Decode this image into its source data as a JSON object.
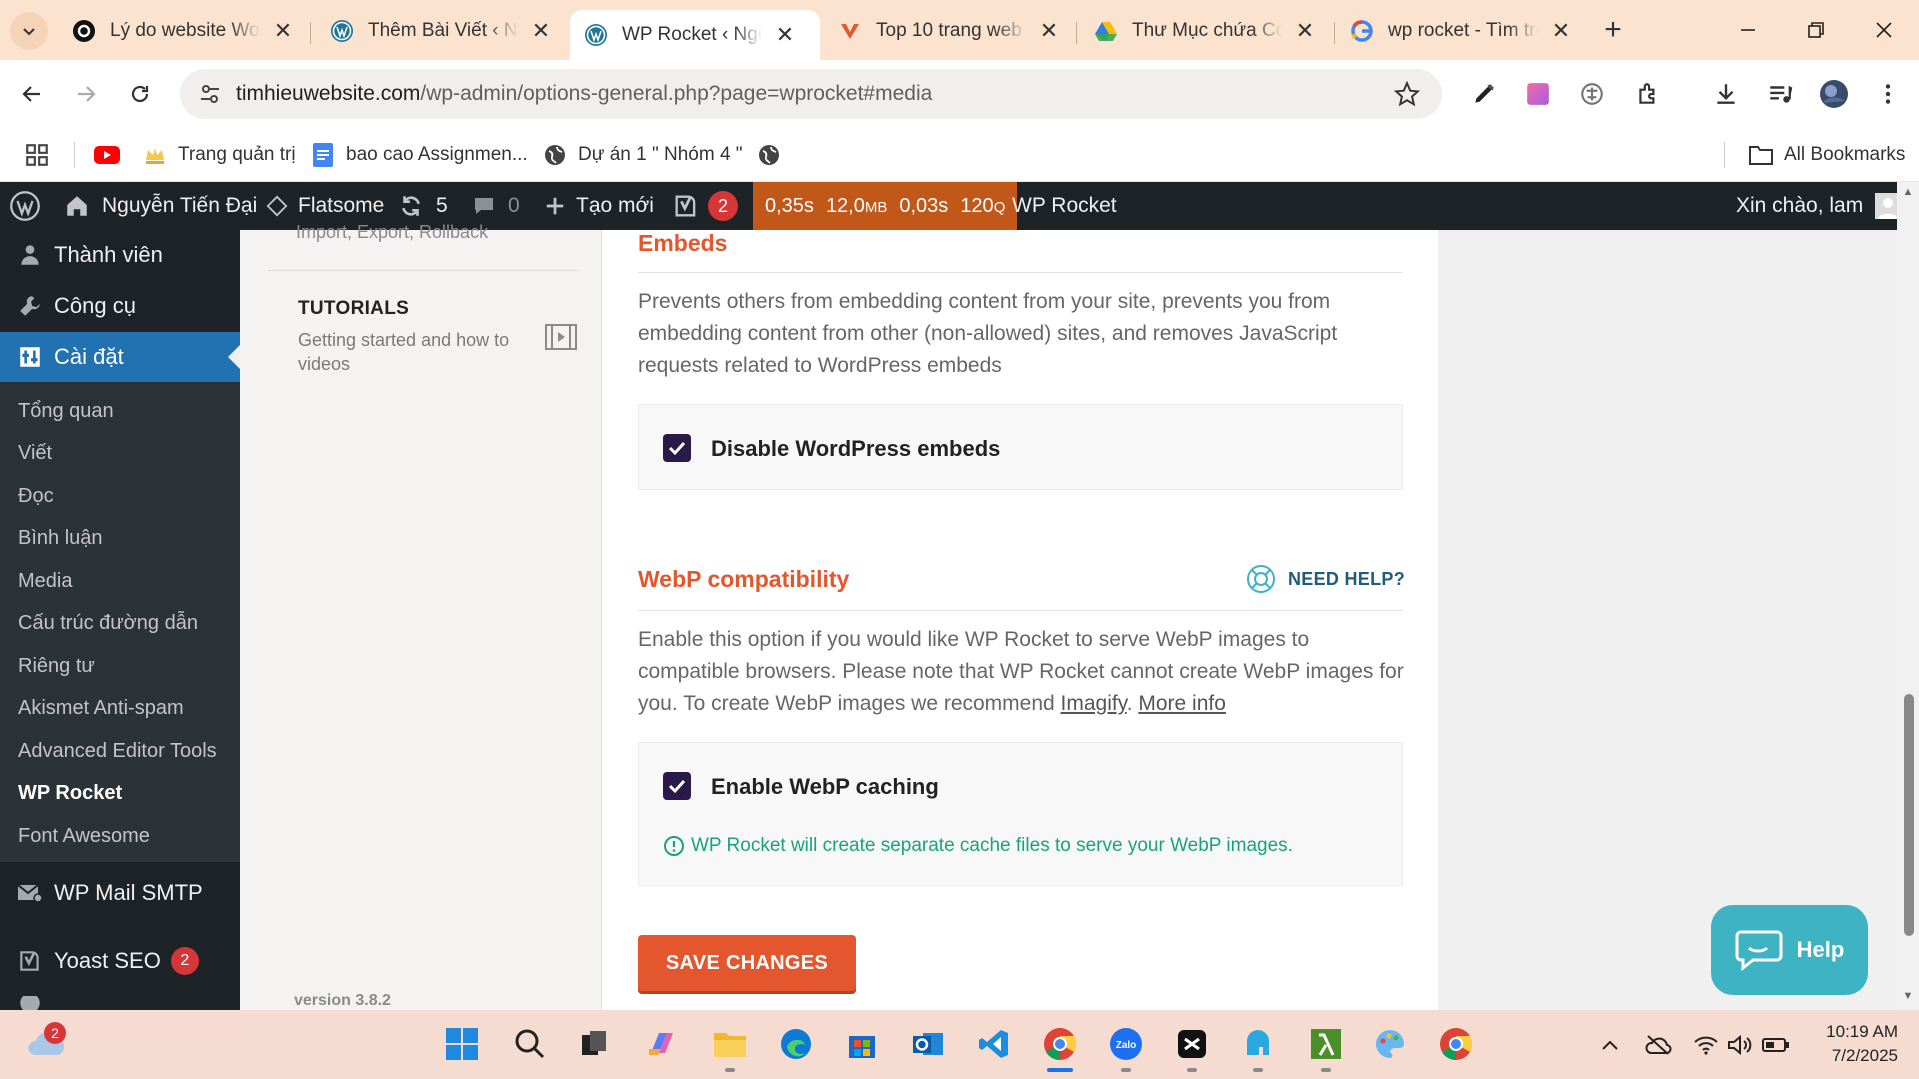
{
  "browser": {
    "tabs": [
      {
        "title": "Lý do website Wor",
        "icon": "threads-icon"
      },
      {
        "title": "Thêm Bài Viết ‹ Ng",
        "icon": "wordpress-icon"
      },
      {
        "title": "WP Rocket ‹ Nguy",
        "icon": "wordpress-icon",
        "active": true
      },
      {
        "title": "Top 10 trang web",
        "icon": "v-logo-icon"
      },
      {
        "title": "Thư Mục chứa Coc",
        "icon": "google-drive-icon"
      },
      {
        "title": "wp rocket - Tìm trê",
        "icon": "google-icon"
      }
    ],
    "url_domain": "timhieuwebsite.com",
    "url_path": "/wp-admin/options-general.php?page=wprocket#media",
    "bookmarks": [
      {
        "label": "",
        "icon": "youtube-icon"
      },
      {
        "label": "Trang quản trị",
        "icon": "crown-icon"
      },
      {
        "label": "bao cao Assignmen...",
        "icon": "docs-icon"
      },
      {
        "label": "Dự án 1 \" Nhóm 4 \"",
        "icon": "globe-icon"
      },
      {
        "label": "",
        "icon": "globe-icon"
      }
    ],
    "all_bookmarks": "All Bookmarks"
  },
  "adminbar": {
    "site_name": "Nguyễn Tiến Đại",
    "theme": "Flatsome",
    "updates": "5",
    "comments": "0",
    "new": "Tạo mới",
    "yoast_count": "2",
    "qm": {
      "time": "0,35s",
      "mem": "12,0",
      "mem_unit": "MB",
      "db": "0,03s",
      "queries": "120",
      "q_unit": "Q"
    },
    "wp_rocket": "WP Rocket",
    "greeting": "Xin chào, lam"
  },
  "sidebar": {
    "top_items": [
      {
        "label": "Thành viên",
        "icon": "users-icon"
      },
      {
        "label": "Công cụ",
        "icon": "tools-icon"
      },
      {
        "label": "Cài đặt",
        "icon": "settings-icon"
      }
    ],
    "sub_items": [
      "Tổng quan",
      "Viết",
      "Đọc",
      "Bình luận",
      "Media",
      "Cấu trúc đường dẫn",
      "Riêng tư",
      "Akismet Anti-spam",
      "Advanced Editor Tools",
      "WP Rocket",
      "Font Awesome"
    ],
    "wp_mail": "WP Mail SMTP",
    "yoast": "Yoast SEO",
    "yoast_count": "2"
  },
  "rocket_nav": {
    "partial_text": "Import, Export, Rollback",
    "tutorials_title": "TUTORIALS",
    "tutorials_desc": "Getting started and how to videos",
    "version": "version 3.8.2"
  },
  "embeds": {
    "title": "Embeds",
    "desc": "Prevents others from embedding content from your site, prevents you from embedding content from other (non-allowed) sites, and removes JavaScript requests related to WordPress embeds",
    "option": "Disable WordPress embeds",
    "checked": true
  },
  "webp": {
    "title": "WebP compatibility",
    "need_help": "NEED HELP?",
    "desc_1": "Enable this option if you would like WP Rocket to serve WebP images to compatible browsers. Please note that WP Rocket cannot create WebP images for you. To create WebP images we recommend ",
    "link_imagify": "Imagify",
    "desc_sep": ". ",
    "link_more": "More info",
    "option": "Enable WebP caching",
    "checked": true,
    "note": "WP Rocket will create separate cache files to serve your WebP images."
  },
  "save_label": "SAVE CHANGES",
  "help_widget": "Help",
  "taskbar": {
    "weather_badge": "2",
    "time": "10:19 AM",
    "date": "7/2/2025"
  }
}
